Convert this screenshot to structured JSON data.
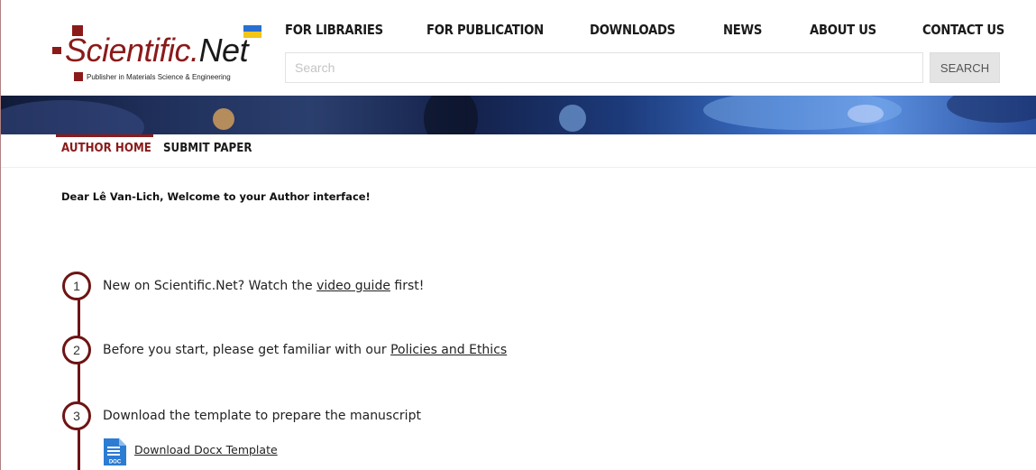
{
  "logo": {
    "word_main": "Scientific.",
    "word_net": "Net",
    "tagline": "Publisher in Materials Science & Engineering",
    "brand_color": "#8b1a1a"
  },
  "nav": {
    "items": [
      "FOR LIBRARIES",
      "FOR PUBLICATION",
      "DOWNLOADS",
      "NEWS",
      "ABOUT US",
      "CONTACT US"
    ]
  },
  "search": {
    "placeholder": "Search",
    "value": "",
    "button_label": "SEARCH"
  },
  "subnav": {
    "items": [
      {
        "label": "AUTHOR HOME",
        "active": true
      },
      {
        "label": "SUBMIT PAPER",
        "active": false
      }
    ]
  },
  "welcome": "Dear Lê Van-Lich, Welcome to your Author interface!",
  "steps": [
    {
      "number": "1",
      "text_before": "New on Scientific.Net? Watch the ",
      "link": "video guide",
      "text_after": " first!"
    },
    {
      "number": "2",
      "text_before": "Before you start, please get familiar with our ",
      "link": "Policies and Ethics",
      "text_after": ""
    },
    {
      "number": "3",
      "text_before": "Download the template to prepare the manuscript",
      "link": "",
      "text_after": ""
    }
  ],
  "download": {
    "icon": "doc-file-icon",
    "icon_label": "DOC",
    "link_label": "Download Docx Template"
  },
  "colors": {
    "accent": "#8b1a1a",
    "timeline": "#6e1414",
    "doc_icon": "#2b7cd3"
  }
}
